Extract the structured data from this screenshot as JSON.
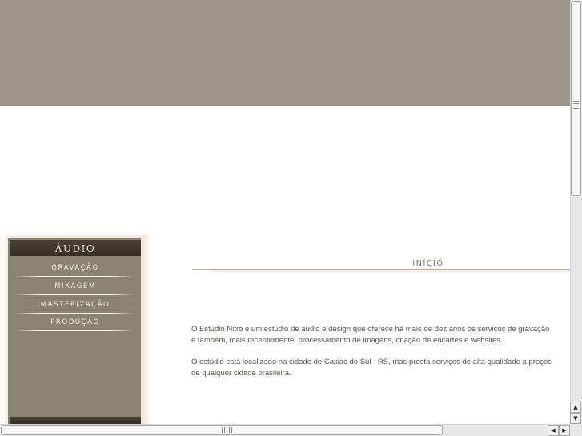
{
  "menu": {
    "header": "ÁUDIO",
    "items": [
      {
        "label": "GRAVAÇÃO"
      },
      {
        "label": "MIXAGEM"
      },
      {
        "label": "MASTERIZAÇÃO"
      },
      {
        "label": "PRODUÇÃO"
      }
    ]
  },
  "content": {
    "title": "INÍCIO",
    "paragraph1": [
      "O Estúdio Nitro é um estúdio de áudio e design que oferece há mais de dez anos os serviços de gravação",
      "e também, mais recentemente, processamento de imagens, criação de encartes e websites."
    ],
    "paragraph2": [
      "O estúdio está localizado na cidade de Caxias do Sul - RS, mas presta serviços de alta qualidade a preços",
      "de qualquer cidade brasileira."
    ]
  },
  "scrollbars": {
    "up_arrow": "▲",
    "down_arrow": "▼",
    "left_arrow": "◀",
    "right_arrow": "▶"
  },
  "colors": {
    "banner": "#9d9588",
    "menu_panel": "#8a8273",
    "menu_header": "#3d352b",
    "title_text": "#7b6e5c",
    "body_text": "#5b5348"
  }
}
